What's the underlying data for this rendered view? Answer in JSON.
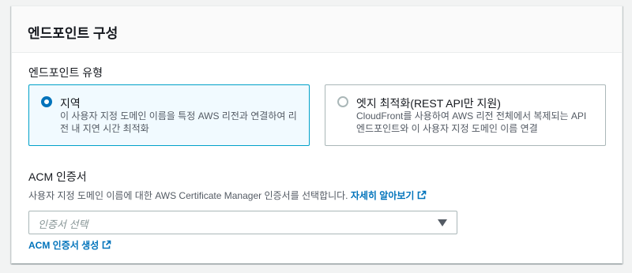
{
  "panel": {
    "title": "엔드포인트 구성"
  },
  "endpoint_type": {
    "label": "엔드포인트 유형",
    "options": [
      {
        "title": "지역",
        "description": "이 사용자 지정 도메인 이름을 특정 AWS 리전과 연결하여 리전 내 지연 시간 최적화",
        "selected": true
      },
      {
        "title": "엣지 최적화(REST API만 지원)",
        "description": "CloudFront를 사용하여 AWS 리전 전체에서 복제되는 API 엔드포인트와 이 사용자 지정 도메인 이름 연결",
        "selected": false
      }
    ]
  },
  "acm": {
    "label": "ACM 인증서",
    "description": "사용자 지정 도메인 이름에 대한 AWS Certificate Manager 인증서를 선택합니다.",
    "learn_more": "자세히 알아보기",
    "select_placeholder": "인증서 선택",
    "create_link": "ACM 인증서 생성"
  },
  "icons": {
    "external": "external-link-icon",
    "caret": "caret-down-icon"
  },
  "colors": {
    "accent": "#0073bb",
    "selected_border": "#00a1c9",
    "selected_bg": "#f1faff"
  }
}
